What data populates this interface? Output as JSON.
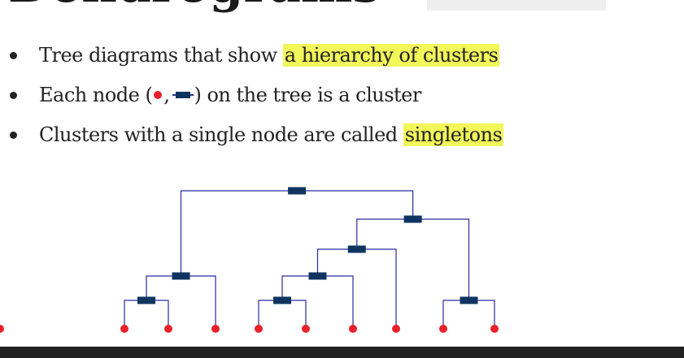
{
  "slide": {
    "title": "Dendrograms",
    "bullets": [
      {
        "before": "Tree diagrams that show ",
        "highlight": "a hierarchy of clusters"
      },
      {
        "before": "Each node (",
        "mid": ",",
        "after": ") on the tree is a cluster"
      },
      {
        "before": "Clusters with a single node are called ",
        "highlight": "singletons"
      }
    ]
  },
  "colors": {
    "edge": "#2a2aa0",
    "internal_node": "#0f3460",
    "leaf_node": "#e8212a",
    "highlight": "#f2f75a"
  },
  "icons": {
    "leaf": "red-dot-icon",
    "internal": "navy-rect-icon"
  },
  "dendrogram": {
    "leaves": 10,
    "merges": [
      {
        "children": [
          0,
          1
        ],
        "height": 1
      },
      {
        "children": [
          10,
          2
        ],
        "height": 2
      },
      {
        "children": [
          3,
          4
        ],
        "height": 1
      },
      {
        "children": [
          12,
          5
        ],
        "height": 2
      },
      {
        "children": [
          13,
          6
        ],
        "height": 3
      },
      {
        "children": [
          7,
          8
        ],
        "height": 1
      },
      {
        "children": [
          14,
          15
        ],
        "height": 4
      },
      {
        "children": [
          11,
          16
        ],
        "height": 5
      }
    ]
  }
}
